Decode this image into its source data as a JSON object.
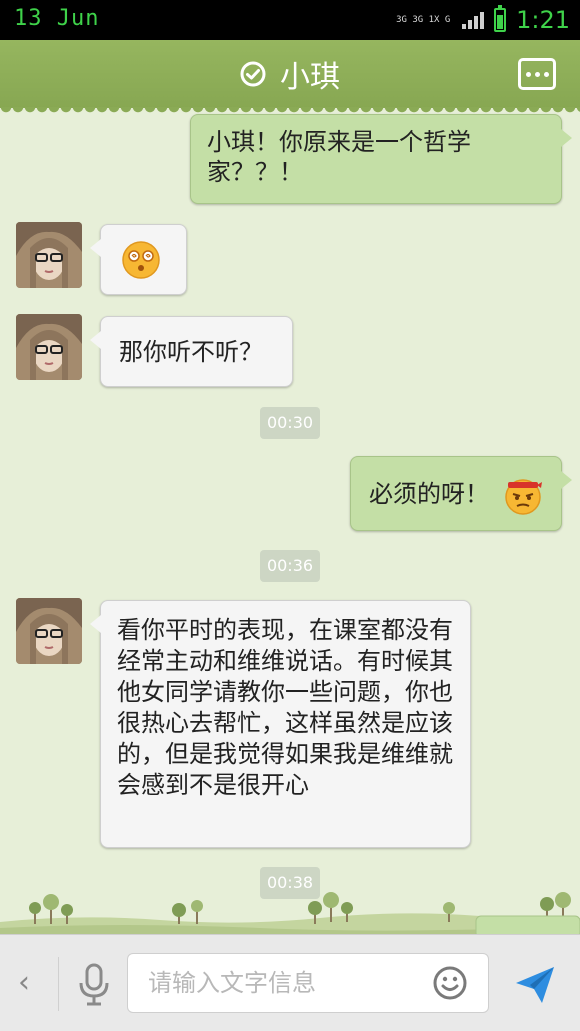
{
  "status_bar": {
    "date": "13 Jun",
    "network": "3G 3G 1X G",
    "time": "1:21"
  },
  "header": {
    "title": "小琪"
  },
  "messages": [
    {
      "side": "right",
      "text": "小琪！你原来是一个哲学家？？！"
    },
    {
      "side": "left",
      "emoji": "dizzy-face"
    },
    {
      "side": "left",
      "text": "那你听不听？"
    },
    {
      "time": "00:30"
    },
    {
      "side": "right",
      "text": "必须的呀！",
      "emoji": "headband-face"
    },
    {
      "time": "00:36"
    },
    {
      "side": "left",
      "text": "看你平时的表现，在课室都没有经常主动和维维说话。有时候其他女同学请教你一些问题，你也很热心去帮忙，这样虽然是应该的，但是我觉得如果我是维维就会感到不是很开心"
    },
    {
      "time": "00:38"
    }
  ],
  "input_bar": {
    "placeholder": "请输入文字信息"
  },
  "colors": {
    "header_green": "#8faf5a",
    "sent_bubble": "#c4dfa6",
    "received_bubble": "#f5f5f5",
    "status_green": "#3fd24a"
  }
}
